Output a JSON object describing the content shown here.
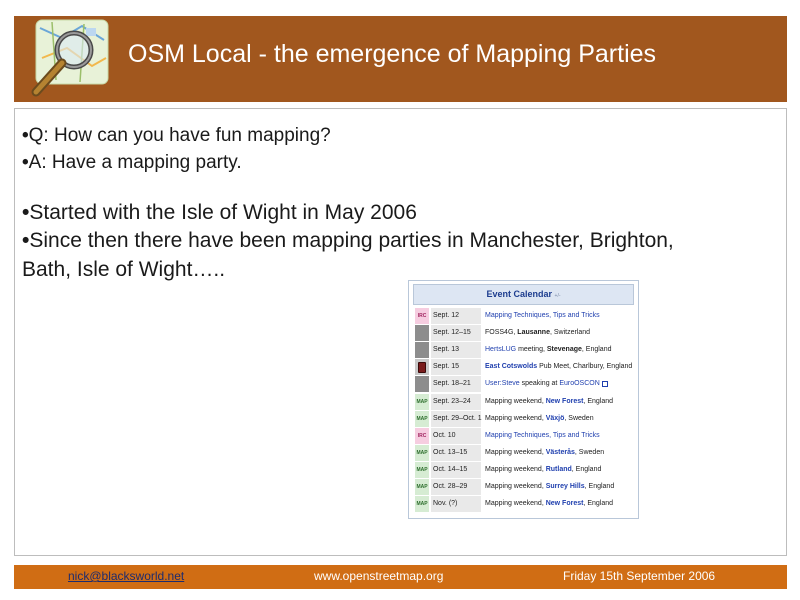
{
  "slide": {
    "title": "OSM Local - the emergence of Mapping Parties"
  },
  "bullets": [
    {
      "text": "Q: How can you have fun mapping?"
    },
    {
      "text": "A: Have a mapping party."
    },
    {
      "text": "Started with the Isle of Wight in May 2006"
    },
    {
      "text": "Since then there have been mapping parties in Manchester, Brighton,"
    },
    {
      "text": "Bath, Isle of Wight….."
    }
  ],
  "calendar": {
    "header": "Event Calendar",
    "header_more": "+/-",
    "rows": [
      {
        "tag": "IRC",
        "tag_class": "irc",
        "date": "Sept. 12",
        "parts": [
          {
            "t": "Mapping Techniques, Tips and Tricks",
            "c": "lnk"
          }
        ]
      },
      {
        "tag": "",
        "tag_class": "gray",
        "date": "Sept. 12–15",
        "parts": [
          {
            "t": "FOSS4G, ",
            "c": ""
          },
          {
            "t": "Lausanne",
            "c": "b"
          },
          {
            "t": ", Switzerland",
            "c": ""
          }
        ]
      },
      {
        "tag": "",
        "tag_class": "gray",
        "date": "Sept. 13",
        "parts": [
          {
            "t": "HertsLUG",
            "c": "lnk"
          },
          {
            "t": " meeting, ",
            "c": ""
          },
          {
            "t": "Stevenage",
            "c": "b"
          },
          {
            "t": ", England",
            "c": ""
          }
        ]
      },
      {
        "tag": "",
        "tag_class": "beer",
        "date": "Sept. 15",
        "parts": [
          {
            "t": "East Cotswolds",
            "c": "blnk"
          },
          {
            "t": " Pub Meet, Charlbury, England",
            "c": ""
          }
        ]
      },
      {
        "tag": "",
        "tag_class": "gray",
        "date": "Sept. 18–21",
        "parts": [
          {
            "t": "User:Steve",
            "c": "lnk"
          },
          {
            "t": " speaking at ",
            "c": ""
          },
          {
            "t": "EuroOSCON",
            "c": "lnk"
          },
          {
            "t": "",
            "c": "ext"
          }
        ]
      },
      {
        "tag": "MAP",
        "tag_class": "map",
        "date": "Sept. 23–24",
        "parts": [
          {
            "t": "Mapping weekend, ",
            "c": ""
          },
          {
            "t": "New Forest",
            "c": "blnk"
          },
          {
            "t": ", England",
            "c": ""
          }
        ]
      },
      {
        "tag": "MAP",
        "tag_class": "map",
        "date": "Sept. 29–Oct. 1",
        "parts": [
          {
            "t": "Mapping weekend, ",
            "c": ""
          },
          {
            "t": "Växjö",
            "c": "blnk"
          },
          {
            "t": ", Sweden",
            "c": ""
          }
        ]
      },
      {
        "tag": "IRC",
        "tag_class": "irc",
        "date": "Oct. 10",
        "parts": [
          {
            "t": "Mapping Techniques, Tips and Tricks",
            "c": "lnk"
          }
        ]
      },
      {
        "tag": "MAP",
        "tag_class": "map",
        "date": "Oct. 13–15",
        "parts": [
          {
            "t": "Mapping weekend, ",
            "c": ""
          },
          {
            "t": "Västerås",
            "c": "blnk"
          },
          {
            "t": ", Sweden",
            "c": ""
          }
        ]
      },
      {
        "tag": "MAP",
        "tag_class": "map",
        "date": "Oct. 14–15",
        "parts": [
          {
            "t": "Mapping weekend, ",
            "c": ""
          },
          {
            "t": "Rutland",
            "c": "blnk"
          },
          {
            "t": ", England",
            "c": ""
          }
        ]
      },
      {
        "tag": "MAP",
        "tag_class": "map",
        "date": "Oct. 28–29",
        "parts": [
          {
            "t": "Mapping weekend, ",
            "c": ""
          },
          {
            "t": "Surrey Hills",
            "c": "blnk"
          },
          {
            "t": ", England",
            "c": ""
          }
        ]
      },
      {
        "tag": "MAP",
        "tag_class": "map",
        "date": "Nov. (?)",
        "parts": [
          {
            "t": "Mapping weekend, ",
            "c": ""
          },
          {
            "t": "New Forest",
            "c": "blnk"
          },
          {
            "t": ", England",
            "c": ""
          }
        ]
      }
    ]
  },
  "footer": {
    "email": "nick@blacksworld.net",
    "website": "www.openstreetmap.org",
    "date": "Friday 15th September 2006"
  },
  "colors": {
    "title_bar": "#a1571e",
    "footer_bar": "#d06d14",
    "link": "#1f3fae"
  },
  "icons": {
    "logo": "osm-magnifier-map-logo-icon"
  }
}
